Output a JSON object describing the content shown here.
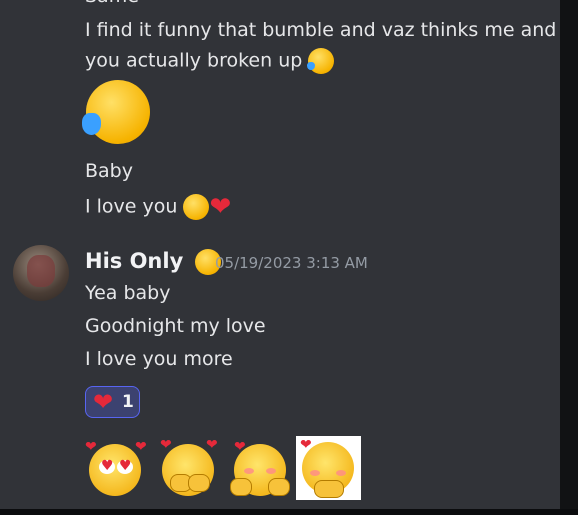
{
  "messages_prev": {
    "partial_top": "Same",
    "line1": "I find it funny that bumble and vaz thinks me and",
    "line2": "you actually broken up",
    "line3": "Baby",
    "line4": "I love you"
  },
  "message": {
    "username": "His Only",
    "timestamp": "05/19/2023 3:13 AM",
    "lines": [
      "Yea baby",
      "Goodnight my love",
      "I love you more"
    ],
    "reaction": {
      "emoji": "heart",
      "count": "1"
    }
  },
  "stickers": [
    "heart-eyes-sticker",
    "shy-hands-sticker",
    "hugging-sticker",
    "pleading-sticker"
  ],
  "colors": {
    "background": "#313338",
    "username": "#f2f3f5",
    "timestamp": "#949ba4",
    "reaction_bg": "#3c4270",
    "reaction_border": "#5865f2"
  }
}
